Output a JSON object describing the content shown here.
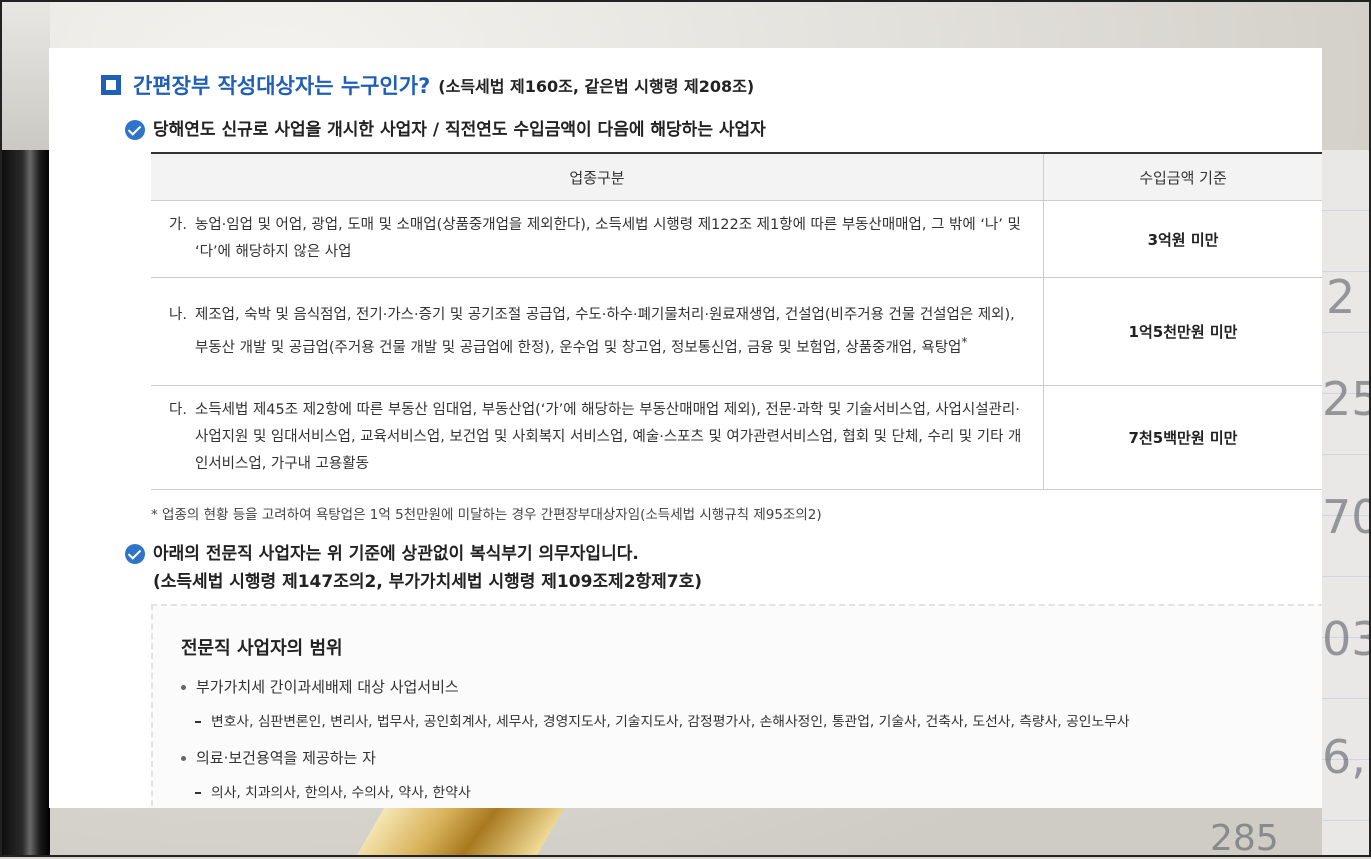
{
  "background": {
    "numbers": [
      "2",
      "25",
      "70",
      "03",
      "6,",
      "285"
    ]
  },
  "heading": {
    "title": "간편장부 작성대상자는 누구인가?",
    "law": "(소득세법 제160조, 같은법 시행령 제208조)"
  },
  "section1": {
    "title": "당해연도 신규로 사업을 개시한 사업자 / 직전연도 수입금액이 다음에 해당하는 사업자"
  },
  "table": {
    "headers": [
      "업종구분",
      "수입금액 기준"
    ],
    "rows": [
      {
        "marker": "가.",
        "text": "농업·임업 및 어업, 광업, 도매 및 소매업(상품중개업을 제외한다), 소득세법 시행령 제122조 제1항에 따른 부동산매매업, 그 밖에 ‘나’ 및 ‘다’에 해당하지 않은 사업",
        "sup": "",
        "amount": "3억원 미만"
      },
      {
        "marker": "나.",
        "text": "제조업, 숙박 및 음식점업, 전기·가스·증기 및 공기조절 공급업, 수도·하수·폐기물처리·원료재생업, 건설업(비주거용 건물 건설업은 제외), 부동산 개발 및 공급업(주거용 건물 개발 및 공급업에 한정), 운수업 및 창고업, 정보통신업, 금융 및 보험업, 상품중개업, 욕탕업",
        "sup": "*",
        "amount": "1억5천만원 미만"
      },
      {
        "marker": "다.",
        "text": "소득세법 제45조 제2항에 따른 부동산 임대업, 부동산업(‘가’에 해당하는 부동산매매업 제외), 전문·과학 및 기술서비스업, 사업시설관리·사업지원 및 임대서비스업, 교육서비스업, 보건업 및 사회복지 서비스업, 예술·스포츠 및 여가관련서비스업, 협회 및 단체, 수리 및 기타 개인서비스업, 가구내 고용활동",
        "sup": "",
        "amount": "7천5백만원 미만"
      }
    ],
    "note": "* 업종의 현황 등을 고려하여 욕탕업은 1억 5천만원에 미달하는 경우 간편장부대상자임(소득세법 시행규칙 제95조의2)"
  },
  "section2": {
    "title": "아래의 전문직 사업자는 위 기준에 상관없이 복식부기 의무자입니다.",
    "law": "(소득세법 시행령 제147조의2, 부가가치세법 시행령 제109조제2항제7호)"
  },
  "box": {
    "title": "전문직 사업자의 범위",
    "groups": [
      {
        "label": "부가가치세 간이과세배제 대상 사업서비스",
        "detail": "변호사, 심판변론인, 변리사, 법무사, 공인회계사, 세무사, 경영지도사, 기술지도사, 감정평가사, 손해사정인, 통관업, 기술사, 건축사, 도선사, 측량사, 공인노무사"
      },
      {
        "label": "의료·보건용역을 제공하는 자",
        "detail": "의사, 치과의사, 한의사, 수의사, 약사, 한약사"
      }
    ]
  },
  "colors": {
    "accent": "#1f5fb5",
    "check": "#2f74c8",
    "text": "#222222"
  }
}
